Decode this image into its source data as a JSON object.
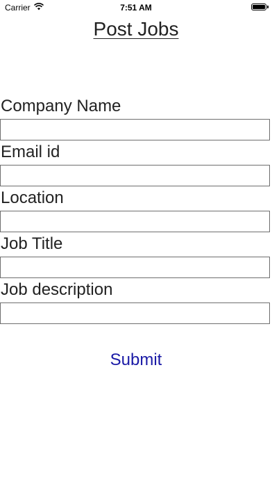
{
  "status_bar": {
    "carrier": "Carrier",
    "time": "7:51 AM",
    "wifi_icon": "wifi-icon",
    "battery_icon": "battery-icon",
    "battery_level": 1.0
  },
  "page": {
    "title": "Post Jobs"
  },
  "form": {
    "fields": [
      {
        "label": "Company Name",
        "value": "",
        "placeholder": ""
      },
      {
        "label": "Email id",
        "value": "",
        "placeholder": ""
      },
      {
        "label": "Location",
        "value": "",
        "placeholder": ""
      },
      {
        "label": "Job Title",
        "value": "",
        "placeholder": ""
      },
      {
        "label": "Job description",
        "value": "",
        "placeholder": ""
      }
    ],
    "submit_label": "Submit"
  },
  "colors": {
    "submit_text": "#1a1aa6",
    "input_border": "#6e6e6e"
  }
}
